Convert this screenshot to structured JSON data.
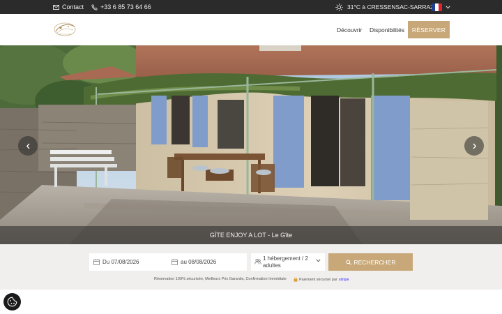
{
  "topbar": {
    "contact_label": "Contact",
    "phone": "+33 6 85 73 64 66",
    "weather": "31°C à CRESSENSAC-SARRAZAC",
    "language_flag_colors": [
      "#1f3f93",
      "#ffffff",
      "#e1222c"
    ]
  },
  "header": {
    "logo": "gite-logo",
    "nav": {
      "decouvrir": "Découvrir",
      "disponibilites": "Disponibilités",
      "reserver": "RÉSERVER"
    }
  },
  "hero": {
    "caption": "GÎTE ENJOY A LOT - Le Gîte",
    "prev_icon": "chevron-left-icon",
    "next_icon": "chevron-right-icon"
  },
  "booking": {
    "from_date": "Du 07/08/2026",
    "to_date": "au 08/08/2026",
    "guests": "1 hébergement / 2 adultes",
    "search_label": "RECHERCHER",
    "assurance": "Réservation 100% sécurisée, Meilleurs Prix Garantis, Confirmation Immédiate",
    "secure_payment": "Paiement sécurisé par",
    "payment_provider": "stripe"
  },
  "colors": {
    "accent": "#c8a878",
    "topbar_bg": "#2b2b2b",
    "booking_bg": "#f1efed"
  }
}
